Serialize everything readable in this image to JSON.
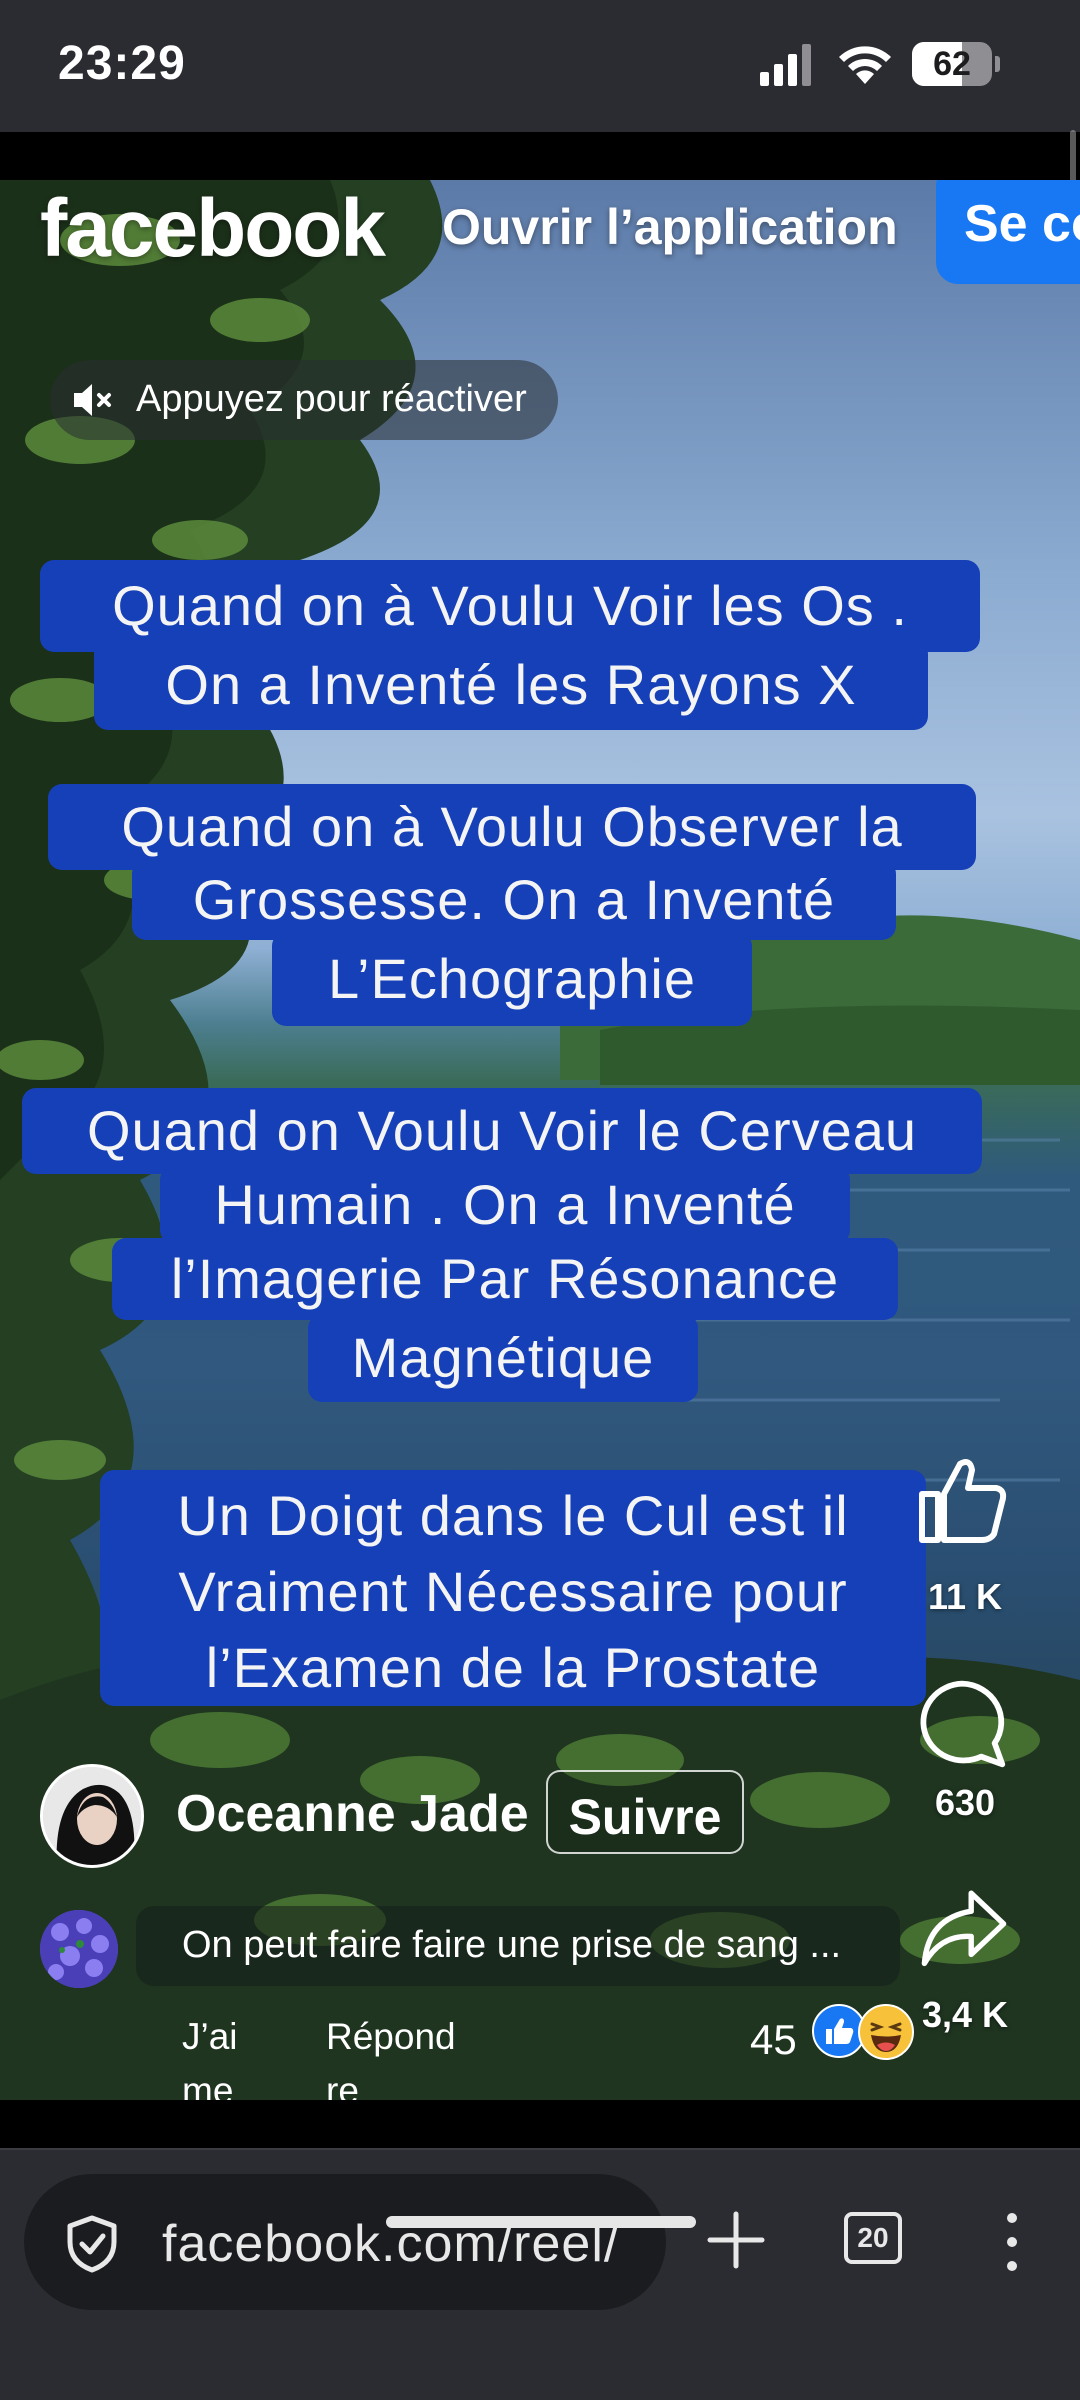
{
  "status_bar": {
    "time": "23:29",
    "battery_level": "62",
    "battery_fraction": 0.62,
    "icons": [
      "signal-icon",
      "wifi-icon",
      "battery-icon"
    ]
  },
  "header": {
    "logo": "facebook",
    "open_app": "Ouvrir l’application",
    "login": "Se co",
    "accent_color": "#1877f2"
  },
  "video": {
    "mute_hint": "Appuyez pour réactiver",
    "captions": [
      {
        "lines": [
          "Quand on à Voulu Voir les Os .",
          "On a Inventé les Rayons X"
        ]
      },
      {
        "lines": [
          "Quand on à Voulu Observer la",
          "Grossesse. On a Inventé",
          "L’Echographie"
        ]
      },
      {
        "lines": [
          "Quand on Voulu Voir le Cerveau",
          "Humain . On a Inventé",
          "l’Imagerie Par Résonance",
          "Magnétique"
        ]
      },
      {
        "lines": [
          "Un Doigt dans le Cul est il",
          "Vraiment Nécessaire pour",
          "l’Examen de la Prostate"
        ]
      }
    ],
    "caption_color": "#1640b8"
  },
  "actions": {
    "likes": "11 K",
    "comments": "630",
    "shares": "3,4 K"
  },
  "author": {
    "name": "Oceanne Jade",
    "follow": "Suivre"
  },
  "comment": {
    "text": "On peut faire faire une prise de sang ...",
    "like_label": "J’ai me",
    "reply_label": "Répond re",
    "reaction_count": "45",
    "reactions": [
      "like-reaction-icon",
      "haha-reaction-icon"
    ]
  },
  "browser": {
    "url": "facebook.com/reel/",
    "tab_count": "20",
    "icons": [
      "shield-icon",
      "new-tab-icon",
      "tabs-icon",
      "menu-icon"
    ]
  }
}
